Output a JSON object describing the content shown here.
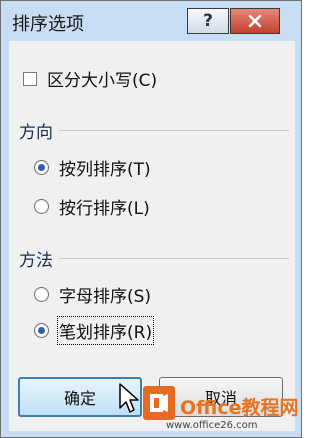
{
  "window": {
    "title": "排序选项",
    "help_label": "?"
  },
  "options": {
    "case_sensitive_label": "区分大小写(C)",
    "case_sensitive_checked": false
  },
  "orientation": {
    "group_label": "方向",
    "items": [
      {
        "label": "按列排序(T)",
        "selected": true
      },
      {
        "label": "按行排序(L)",
        "selected": false
      }
    ]
  },
  "method": {
    "group_label": "方法",
    "items": [
      {
        "label": "字母排序(S)",
        "selected": false
      },
      {
        "label": "笔划排序(R)",
        "selected": true
      }
    ]
  },
  "buttons": {
    "ok_label": "确定",
    "cancel_label": "取消"
  },
  "watermark": {
    "brand": "Office教程网",
    "url": "www.office26.com"
  },
  "colors": {
    "title_bar": "#c6ddf3",
    "close_button": "#c3402c",
    "radio_dot": "#2f5fb0",
    "watermark": "#e66a24"
  },
  "icons": [
    "help-icon",
    "close-icon",
    "mouse-cursor-icon",
    "office-logo-icon"
  ]
}
